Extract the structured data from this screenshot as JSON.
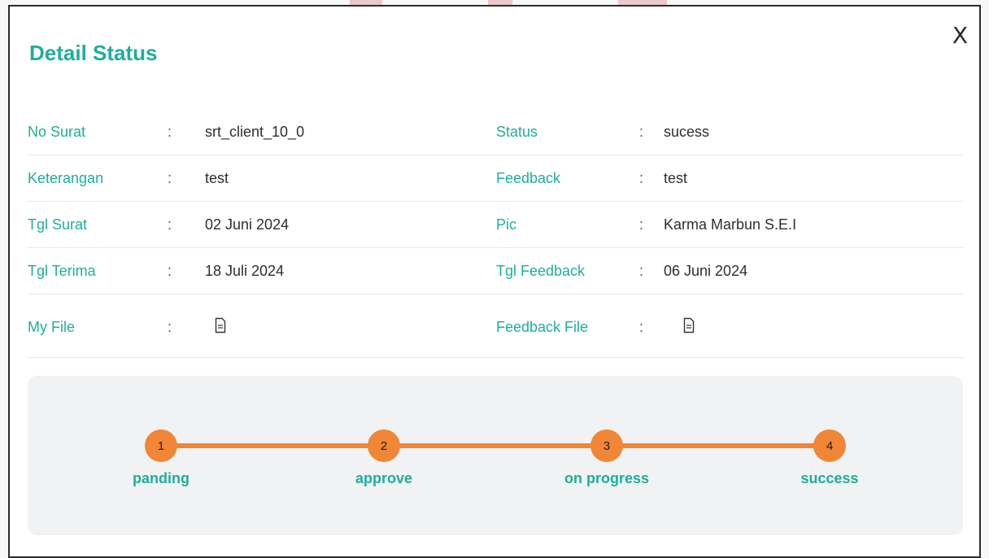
{
  "modal": {
    "title": "Detail Status",
    "close_label": "X"
  },
  "details": {
    "rows": [
      {
        "left_label": "No Surat",
        "left_value": "srt_client_10_0",
        "right_label": "Status",
        "right_value": "sucess"
      },
      {
        "left_label": "Keterangan",
        "left_value": "test",
        "right_label": "Feedback",
        "right_value": "test"
      },
      {
        "left_label": "Tgl Surat",
        "left_value": "02 Juni 2024",
        "right_label": "Pic",
        "right_value": "Karma Marbun S.E.I"
      },
      {
        "left_label": "Tgl Terima",
        "left_value": "18 Juli 2024",
        "right_label": "Tgl Feedback",
        "right_value": "06 Juni 2024"
      }
    ],
    "files": {
      "left_label": "My File",
      "left_icon": "document-icon",
      "right_label": "Feedback File",
      "right_icon": "document-icon"
    },
    "separator": ":"
  },
  "progress": {
    "steps": [
      {
        "number": "1",
        "label": "panding"
      },
      {
        "number": "2",
        "label": "approve"
      },
      {
        "number": "3",
        "label": "on progress"
      },
      {
        "number": "4",
        "label": "success"
      }
    ]
  },
  "colors": {
    "accent": "#1fae9a",
    "step": "#f08636",
    "tracker_bg": "#f0f2f4"
  }
}
